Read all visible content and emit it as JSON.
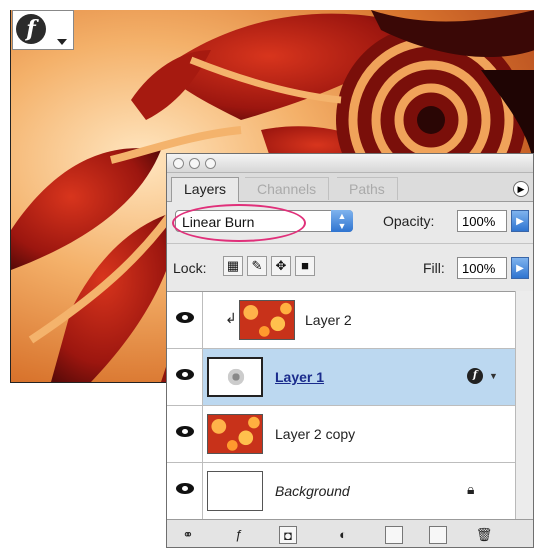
{
  "canvas": {
    "badge_icon": "layer-effects-icon",
    "badge_glyph": "f"
  },
  "palette": {
    "tabs": [
      {
        "label": "Layers",
        "active": true
      },
      {
        "label": "Channels",
        "active": false
      },
      {
        "label": "Paths",
        "active": false
      }
    ],
    "blend_mode": "Linear Burn",
    "opacity_label": "Opacity:",
    "opacity_value": "100%",
    "lock_label": "Lock:",
    "fill_label": "Fill:",
    "fill_value": "100%",
    "highlight_color": "#e0307a",
    "selection_color": "#bcd8f0",
    "layers": [
      {
        "name": "Layer 2",
        "visible": true,
        "clipped": true,
        "thumb": "orange",
        "selected": false
      },
      {
        "name": "Layer 1",
        "visible": true,
        "clipped": false,
        "thumb": "sketch",
        "selected": true,
        "has_effects": true
      },
      {
        "name": "Layer 2 copy",
        "visible": true,
        "clipped": false,
        "thumb": "orange",
        "selected": false
      },
      {
        "name": "Background",
        "visible": true,
        "clipped": false,
        "thumb": "blank",
        "selected": false,
        "locked": true
      }
    ],
    "bottom_icons": [
      "link-layers-icon",
      "add-style-icon",
      "add-mask-icon",
      "adjustment-layer-icon",
      "new-group-icon",
      "new-layer-icon",
      "trash-icon"
    ]
  }
}
